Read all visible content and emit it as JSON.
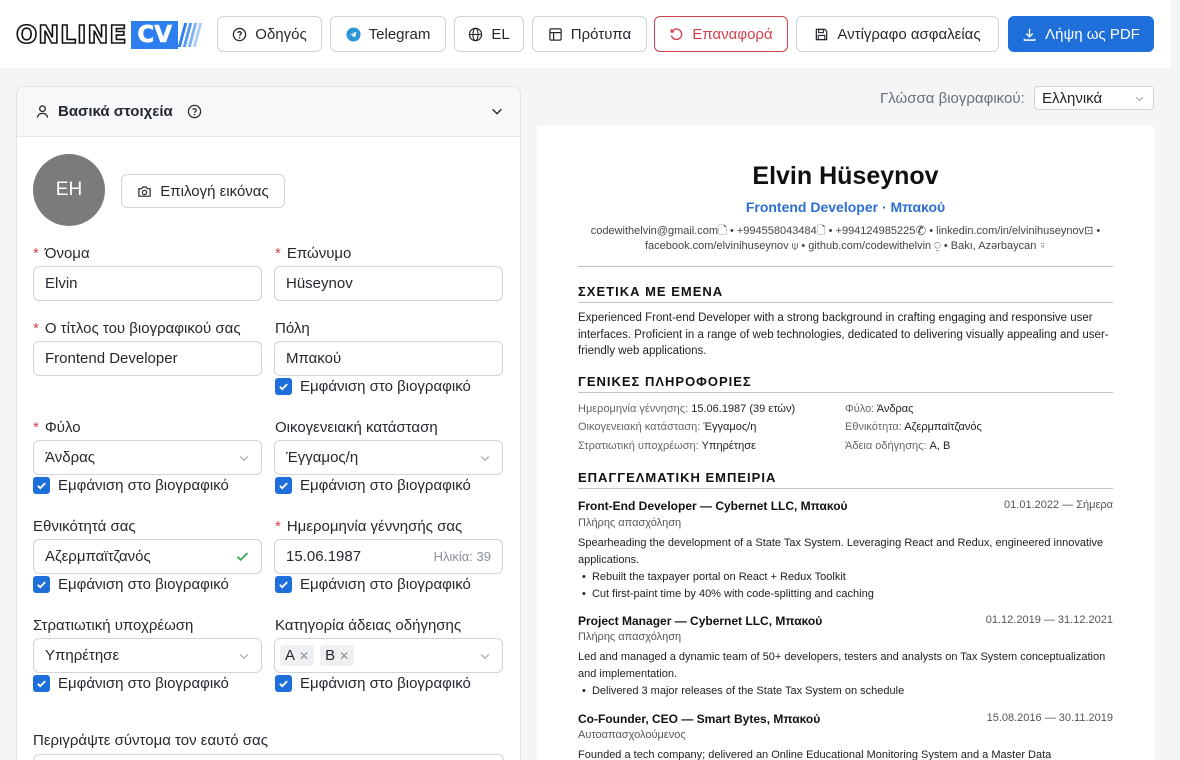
{
  "header": {
    "logo_text": "ONLINE",
    "logo_cv": "CV",
    "buttons": {
      "guide": "Οδηγός",
      "telegram": "Telegram",
      "lang": "EL",
      "templates": "Πρότυπα",
      "reset": "Επαναφορά",
      "backup": "Αντίγραφο ασφαλείας",
      "pdf": "Λήψη ως PDF"
    }
  },
  "panel": {
    "title": "Βασικά στοιχεία",
    "avatar_initials": "EH",
    "choose_image": "Επιλογή εικόνας",
    "fields": {
      "first_name": {
        "label": "Όνομα",
        "value": "Elvin"
      },
      "last_name": {
        "label": "Επώνυμο",
        "value": "Hüseynov"
      },
      "cv_title": {
        "label": "Ο τίτλος του βιογραφικού σας",
        "value": "Frontend Developer"
      },
      "city": {
        "label": "Πόλη",
        "value": "Μπακού"
      },
      "gender": {
        "label": "Φύλο",
        "value": "Άνδρας"
      },
      "marital": {
        "label": "Οικογενειακή κατάσταση",
        "value": "Έγγαμος/η"
      },
      "nationality": {
        "label": "Εθνικότητά σας",
        "value": "Αζερμπαϊτζανός"
      },
      "birthdate": {
        "label": "Ημερομηνία γέννησής σας",
        "value": "15.06.1987",
        "age": "Ηλικία: 39"
      },
      "military": {
        "label": "Στρατιωτική υποχρέωση",
        "value": "Υπηρέτησε"
      },
      "license": {
        "label": "Κατηγορία άδειας οδήγησης",
        "tags": [
          "A",
          "B"
        ]
      },
      "about": {
        "label": "Περιγράψτε σύντομα τον εαυτό σας"
      }
    },
    "show_in_cv": "Εμφάνιση στο βιογραφικό"
  },
  "preview": {
    "lang_label": "Γλώσσα βιογραφικού:",
    "lang_value": "Ελληνικά",
    "name": "Elvin Hüseynov",
    "title": "Frontend Developer · Μπακού",
    "contacts_line1": "codewithelvin@gmail.com🗋 • +994558043484🗋 • +994124985225✆ • linkedin.com/in/elvinihuseynov⊡ •",
    "contacts_line2": "facebook.com/elvinihuseynov ⍦ • github.com/codewithelvin ⍜ • Bakı, Azərbaycan ⍤",
    "about_heading": "ΣΧΕΤΙΚΑ ΜΕ ΕΜΕΝΑ",
    "about_text": "Experienced Front-end Developer with a strong background in crafting engaging and responsive user interfaces. Proficient in a range of web technologies, dedicated to delivering visually appealing and user-friendly web applications.",
    "general_heading": "ΓΕΝΙΚΕΣ ΠΛΗΡΟΦΟΡΙΕΣ",
    "general": {
      "birth_k": "Ημερομηνία γέννησης:",
      "birth_v": "15.06.1987 (39 ετών)",
      "gender_k": "Φύλο:",
      "gender_v": "Άνδρας",
      "marital_k": "Οικογενειακή κατάσταση:",
      "marital_v": "Έγγαμος/η",
      "nation_k": "Εθνικότητα:",
      "nation_v": "Αζερμπαϊτζανός",
      "military_k": "Στρατιωτική υποχρέωση:",
      "military_v": "Υπηρέτησε",
      "license_k": "Άδεια οδήγησης:",
      "license_v": "A, B"
    },
    "exp_heading": "ΕΠΑΓΓΕΛΜΑΤΙΚΗ ΕΜΠΕΙΡΙΑ",
    "jobs": [
      {
        "title": "Front-End Developer — Cybernet LLC, Μπακού",
        "date": "01.01.2022 — Σήμερα",
        "type": "Πλήρης απασχόληση",
        "desc": "Spearheading the development of a State Tax System. Leveraging React and Redux, engineered innovative applications.",
        "bullets": [
          "Rebuilt the taxpayer portal on React + Redux Toolkit",
          "Cut first-paint time by 40% with code-splitting and caching"
        ]
      },
      {
        "title": "Project Manager — Cybernet LLC, Μπακού",
        "date": "01.12.2019 — 31.12.2021",
        "type": "Πλήρης απασχόληση",
        "desc": "Led and managed a dynamic team of 50+ developers, testers and analysts on Tax System conceptualization and implementation.",
        "bullets": [
          "Delivered 3 major releases of the State Tax System on schedule"
        ]
      },
      {
        "title": "Co-Founder, CEO — Smart Bytes, Μπακού",
        "date": "15.08.2016 — 30.11.2019",
        "type": "Αυτοαπασχολούμενος",
        "desc": "Founded a tech company; delivered an Online Educational Monitoring System and a Master Data"
      }
    ]
  }
}
